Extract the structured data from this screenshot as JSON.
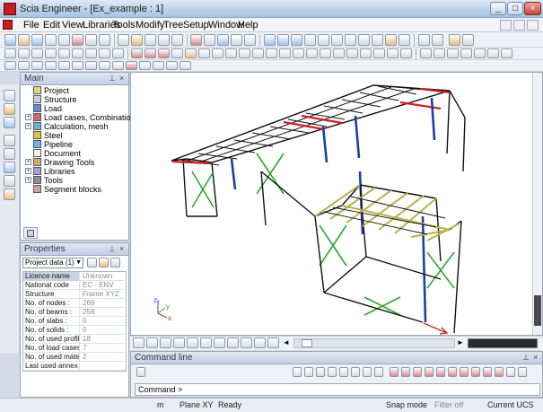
{
  "window": {
    "title": "Scia Engineer - [Ex_example : 1]",
    "minimize": "_",
    "maximize": "□",
    "close": "×"
  },
  "menu": [
    "File",
    "Edit",
    "View",
    "Libraries",
    "Tools",
    "Modify",
    "Tree",
    "Setup",
    "Window",
    "Help"
  ],
  "main_panel": {
    "title": "Main",
    "items": [
      "Project",
      "Structure",
      "Load",
      "Load cases, Combinations",
      "Calculation, mesh",
      "Steel",
      "Pipeline",
      "Document",
      "Drawing Tools",
      "Libraries",
      "Tools",
      "Segment blocks"
    ]
  },
  "properties_panel": {
    "title": "Properties",
    "selector_value": "Project data (1)",
    "rows": [
      {
        "key": "Licence name",
        "value": "Unknown"
      },
      {
        "key": "National code",
        "value": "EC - ENV"
      },
      {
        "key": "Structure",
        "value": "Frame XYZ"
      },
      {
        "key": "No. of nodes :",
        "value": "269"
      },
      {
        "key": "No. of beams :",
        "value": "258"
      },
      {
        "key": "No. of slabs :",
        "value": "0"
      },
      {
        "key": "No. of solids :",
        "value": "0"
      },
      {
        "key": "No. of used profil...",
        "value": "18"
      },
      {
        "key": "No. of load cases :",
        "value": "7"
      },
      {
        "key": "No. of used mate...",
        "value": "2"
      },
      {
        "key": "Last used annex",
        "value": ""
      }
    ]
  },
  "command_panel": {
    "title": "Command line",
    "prompt": "Command >"
  },
  "axes": {
    "x": "x",
    "y": "y",
    "z": "z"
  },
  "status_bar": {
    "units": "m",
    "plane": "Plane XY",
    "state": "Ready",
    "snap": "Snap mode",
    "filter": "Filter off",
    "ucs": "Current UCS"
  },
  "colors": {
    "accent_red": "#d42020",
    "beam_blue": "#1c3fa8",
    "brace_green": "#2ea82e",
    "purlin_yellow": "#b8b04a",
    "frame_black": "#111111"
  }
}
